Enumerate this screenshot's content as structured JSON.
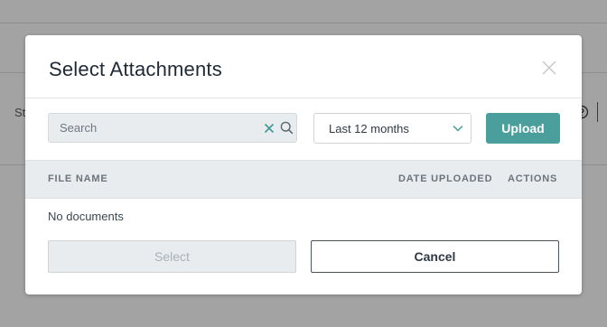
{
  "background": {
    "partial_text": "St"
  },
  "modal": {
    "title": "Select Attachments",
    "search": {
      "placeholder": "Search",
      "value": ""
    },
    "date_filter": {
      "selected": "Last 12 months"
    },
    "upload_label": "Upload",
    "table": {
      "columns": [
        "FILE NAME",
        "DATE UPLOADED",
        "ACTIONS"
      ],
      "rows": [],
      "empty_text": "No documents"
    },
    "select_label": "Select",
    "cancel_label": "Cancel"
  },
  "colors": {
    "accent": "#4a9e9c",
    "overlay": "#a3a3a3",
    "title_text": "#1f2a36",
    "header_bg": "#e9ecef"
  },
  "icons": {
    "close": "close-icon",
    "clear": "clear-icon",
    "search": "search-icon",
    "dropdown": "chevron-down-icon",
    "help": "help-icon"
  }
}
